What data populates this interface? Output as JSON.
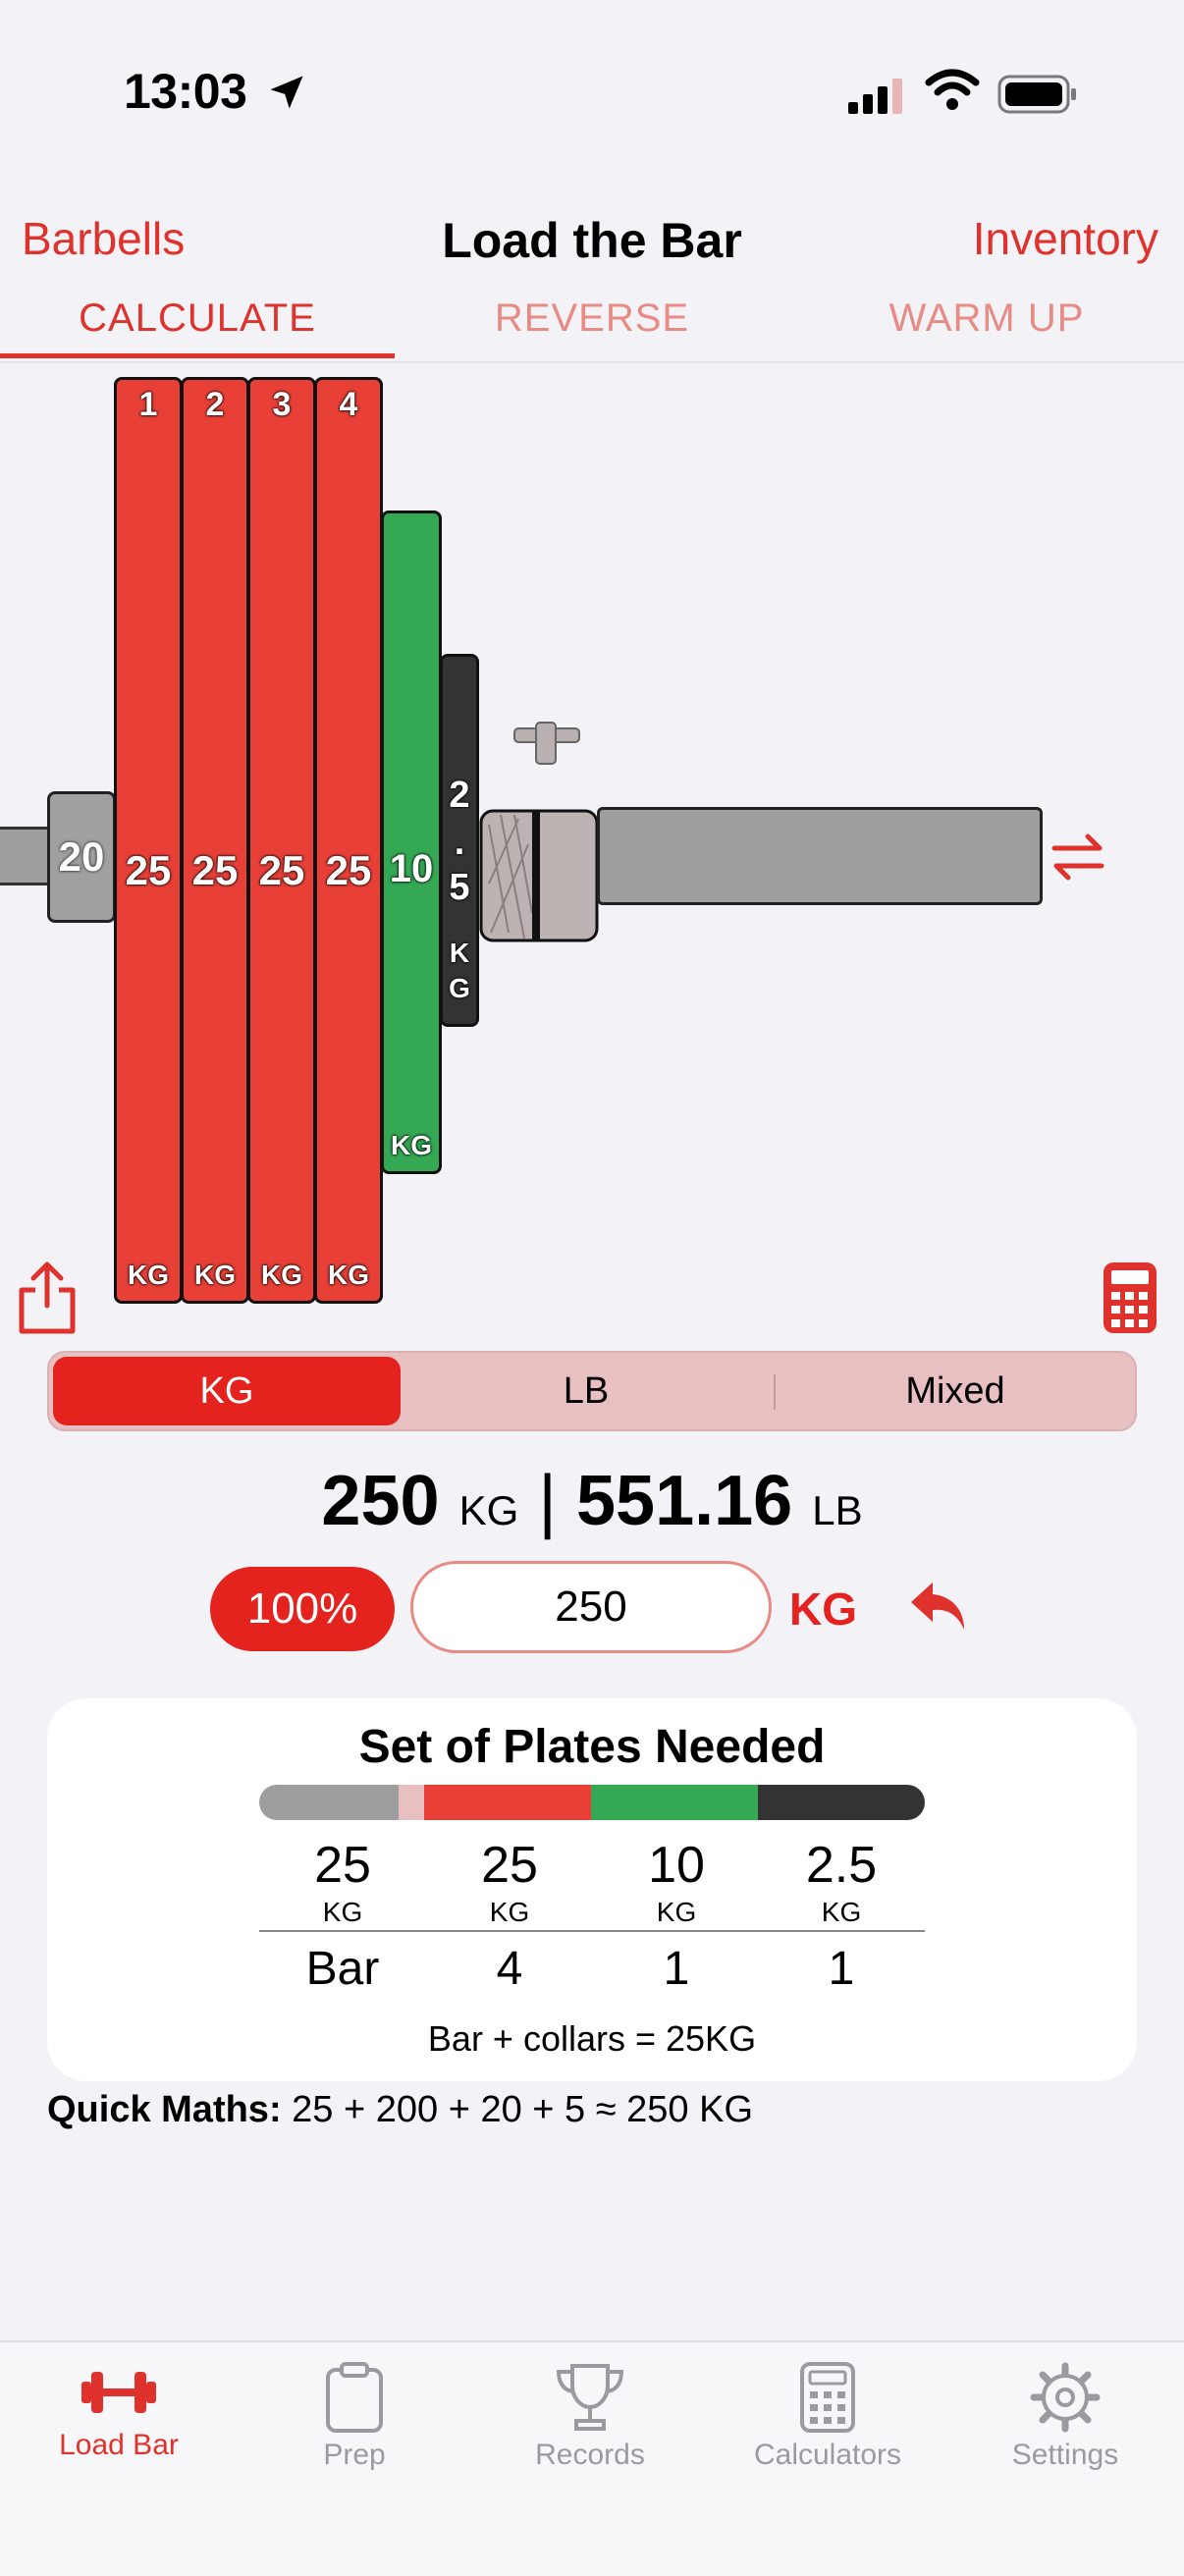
{
  "status": {
    "time": "13:03"
  },
  "nav": {
    "left": "Barbells",
    "title": "Load the Bar",
    "right": "Inventory"
  },
  "tabs": [
    "CALCULATE",
    "REVERSE",
    "WARM UP"
  ],
  "barbell": {
    "collar_weight": "20",
    "plates": [
      {
        "index": "1",
        "weight": "25",
        "unit": "KG"
      },
      {
        "index": "2",
        "weight": "25",
        "unit": "KG"
      },
      {
        "index": "3",
        "weight": "25",
        "unit": "KG"
      },
      {
        "index": "4",
        "weight": "25",
        "unit": "KG"
      }
    ],
    "green_plate": {
      "weight": "10",
      "unit": "KG"
    },
    "black_plate": {
      "chars": [
        "2",
        ".",
        "5"
      ],
      "unit_chars": [
        "K",
        "G"
      ]
    }
  },
  "units": {
    "kg": "KG",
    "lb": "LB",
    "mixed": "Mixed"
  },
  "totals": {
    "kg_value": "250",
    "kg_unit": "KG",
    "separator": "|",
    "lb_value": "551.16",
    "lb_unit": "LB"
  },
  "input": {
    "percent": "100%",
    "value": "250",
    "unit": "KG"
  },
  "card": {
    "title": "Set of Plates Needed",
    "columns": [
      {
        "value": "25",
        "unit": "KG",
        "count": "Bar"
      },
      {
        "value": "25",
        "unit": "KG",
        "count": "4"
      },
      {
        "value": "10",
        "unit": "KG",
        "count": "1"
      },
      {
        "value": "2.5",
        "unit": "KG",
        "count": "1"
      }
    ],
    "footer": "Bar + collars = 25KG",
    "colors": [
      "#9e9e9e",
      "#e8c0c2",
      "#e84037",
      "#34a853",
      "#333333"
    ]
  },
  "quick": {
    "label": "Quick Maths:",
    "text": "25 + 200 + 20 + 5 ≈ 250 KG"
  },
  "tabbar": [
    {
      "label": "Load Bar",
      "icon": "dumbbell-icon"
    },
    {
      "label": "Prep",
      "icon": "clipboard-icon"
    },
    {
      "label": "Records",
      "icon": "trophy-icon"
    },
    {
      "label": "Calculators",
      "icon": "calculator-icon"
    },
    {
      "label": "Settings",
      "icon": "gear-icon"
    }
  ]
}
